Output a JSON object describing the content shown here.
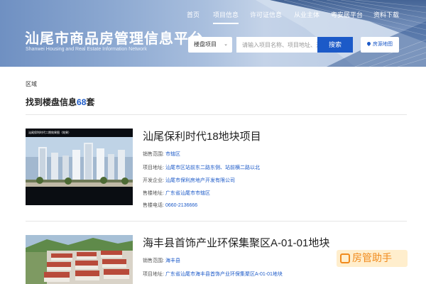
{
  "header": {
    "title": "汕尾市商品房管理信息平台",
    "subtitle": "Shanwei Housing and Real Estate Information Network",
    "nav": [
      {
        "label": "首页",
        "active": false
      },
      {
        "label": "项目信息",
        "active": true
      },
      {
        "label": "许可证信息",
        "active": false
      },
      {
        "label": "从业主体",
        "active": false
      },
      {
        "label": "粤安居平台",
        "active": false
      },
      {
        "label": "资料下载",
        "active": false
      }
    ],
    "search": {
      "select_value": "楼盘项目",
      "placeholder": "请输入项目名称、项目地址、开",
      "button_label": "搜索",
      "map_label": "房源地图"
    }
  },
  "main": {
    "region_label": "区域",
    "result_prefix": "找到楼盘信息",
    "result_count": "68",
    "result_suffix": "套",
    "projects": [
      {
        "image_caption": "汕尾保利时代二期效果图（效果）",
        "title": "汕尾保利时代18地块项目",
        "rows": [
          {
            "key": "销售范围:",
            "value": "市辖区"
          },
          {
            "key": "项目地址:",
            "value": "汕尾市区站前东二路东侧、站前横二路以北"
          },
          {
            "key": "开发企业:",
            "value": "汕尾市保利房地产开发有限公司"
          },
          {
            "key": "售楼地址:",
            "value": "广东省汕尾市市辖区"
          },
          {
            "key": "售楼电话:",
            "value": "0660-2136666"
          }
        ]
      },
      {
        "title": "海丰县首饰产业环保集聚区A-01-01地块",
        "rows": [
          {
            "key": "销售范围:",
            "value": "海丰县"
          },
          {
            "key": "项目地址:",
            "value": "广东省汕尾市海丰县首饰产业环保集聚区A-01-01地块"
          }
        ]
      }
    ]
  },
  "watermark": "房管助手",
  "colors": {
    "accent": "#1c5ac8",
    "watermark": "#f08a1c"
  }
}
